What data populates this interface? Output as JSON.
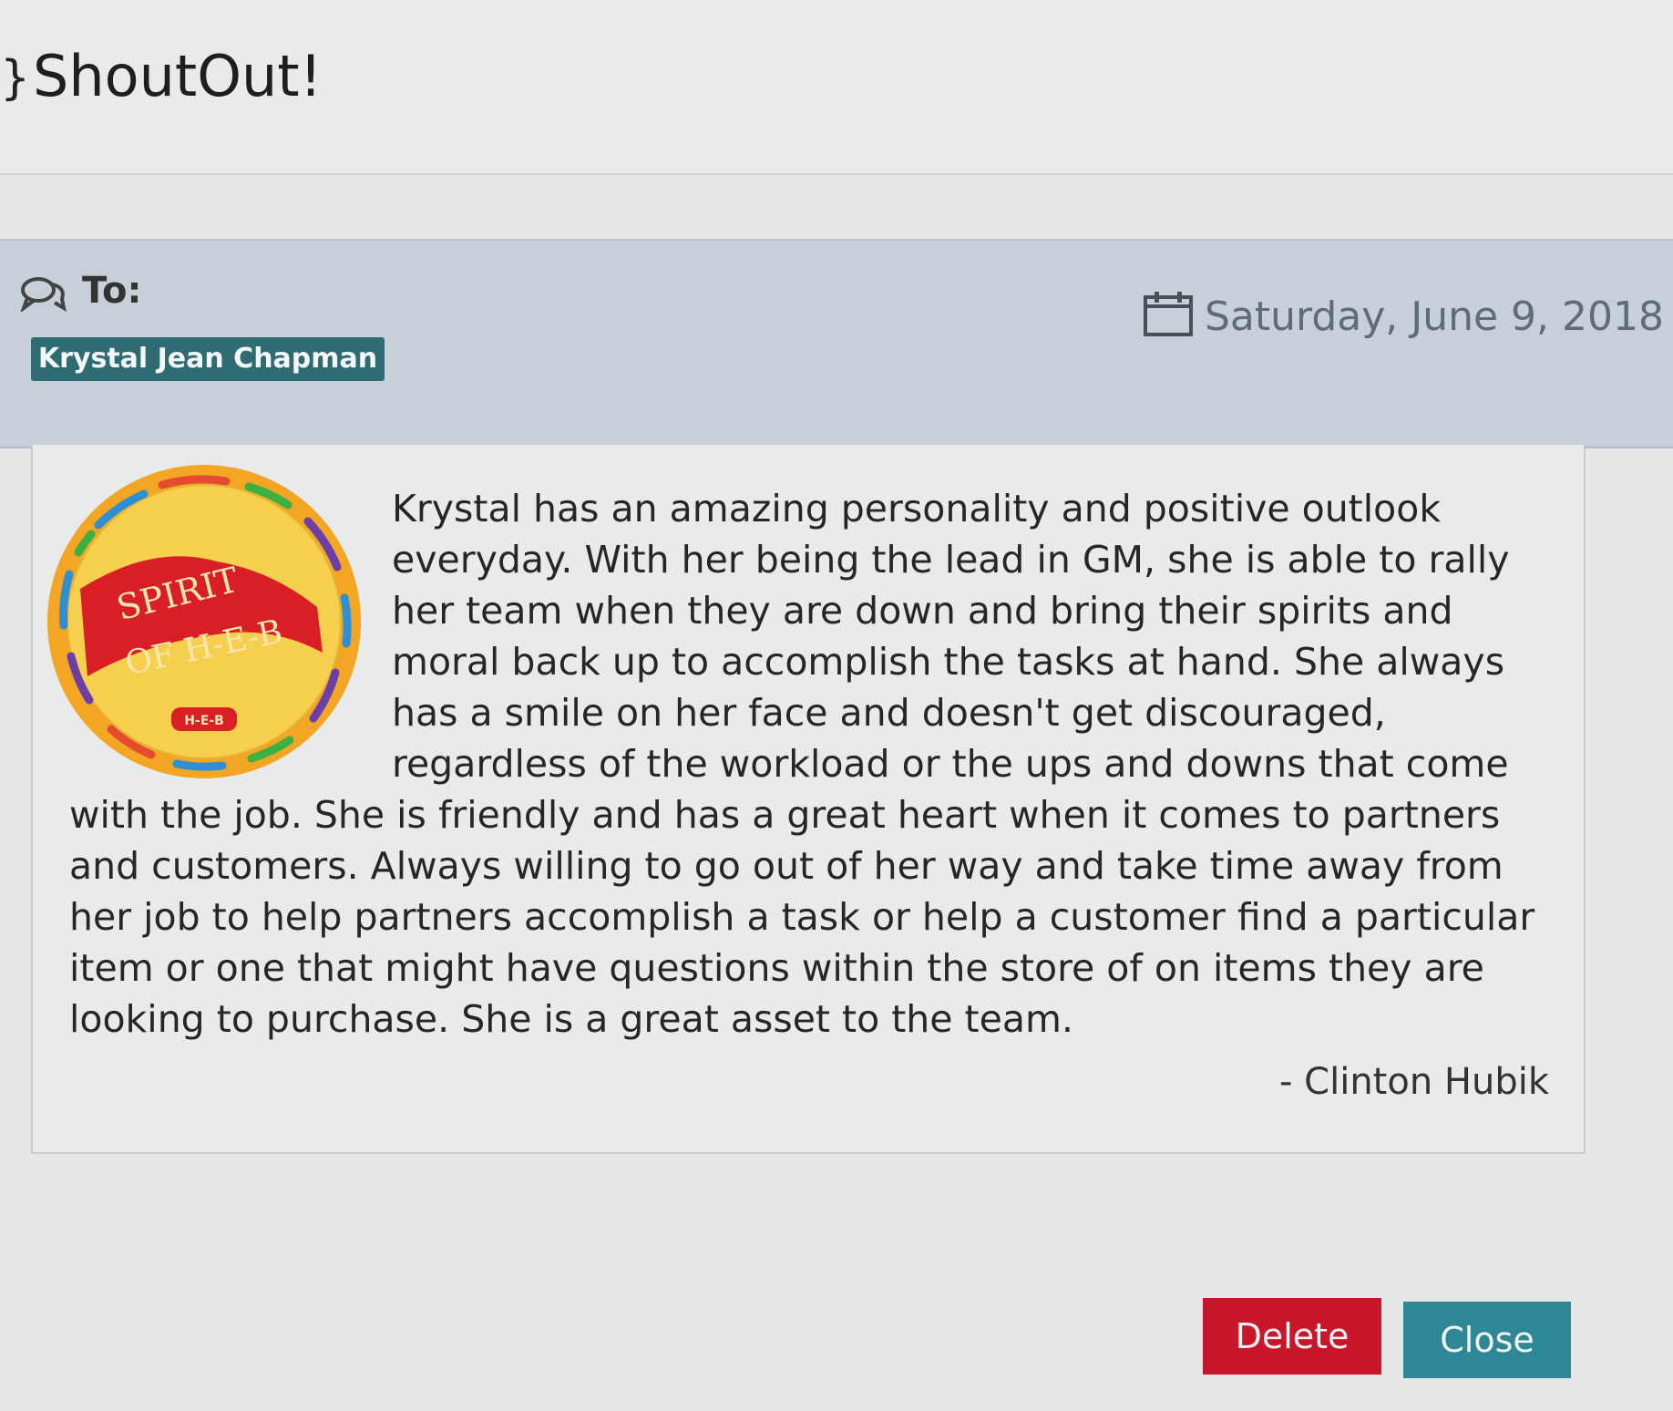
{
  "modal": {
    "title": "ShoutOut!",
    "to_label": "To:",
    "recipient": "Krystal Jean Chapman",
    "date": "Saturday, June 9, 2018"
  },
  "badge": {
    "line1": "SPIRIT",
    "line2": "OF H-E-B",
    "mark": "H-E-B"
  },
  "message": {
    "body": "Krystal has an amazing personality and positive outlook everyday. With her being the lead in GM, she is able to rally her team when they are down and bring their spirits and moral back up to accomplish the tasks at hand.  She always has a smile on her face and doesn't get discouraged, regardless of the workload or the ups and downs that come with the job.  She is friendly and has a great heart when it comes to partners and customers.  Always willing to go out of her way and take time away from her job to help partners accomplish a task or help a customer find a particular item or one that might have questions within the store of on items they are looking to purchase.  She is a great asset to the team.",
    "signature": "- Clinton Hubik"
  },
  "buttons": {
    "delete_label": "Delete",
    "close_label": "Close"
  },
  "colors": {
    "recipient_badge": "#2f6b73",
    "delete_button": "#c8172b",
    "close_button": "#2e8795",
    "info_bar": "#c7cfd8"
  },
  "icons": {
    "title": "trophy-icon",
    "to": "chat-bubbles-icon",
    "date": "calendar-icon"
  }
}
